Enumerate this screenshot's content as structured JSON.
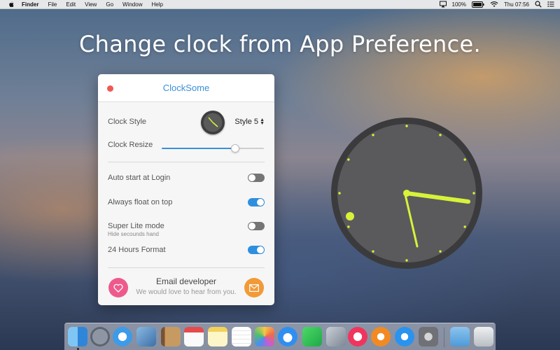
{
  "menubar": {
    "items": [
      {
        "label": "Finder",
        "bold": true
      },
      {
        "label": "File"
      },
      {
        "label": "Edit"
      },
      {
        "label": "View"
      },
      {
        "label": "Go"
      },
      {
        "label": "Window"
      },
      {
        "label": "Help"
      }
    ],
    "battery_percent": "100%",
    "clock": "Thu 07:56"
  },
  "headline": "Change clock from App Preference.",
  "panel": {
    "title": "ClockSome",
    "clock_style_label": "Clock Style",
    "clock_style_value": "Style 5",
    "clock_resize_label": "Clock Resize",
    "clock_resize_level": 0.72,
    "toggles": [
      {
        "label": "Auto start at Login",
        "sublabel": "",
        "on": false
      },
      {
        "label": "Always float on top",
        "sublabel": "",
        "on": true
      },
      {
        "label": "Super Lite mode",
        "sublabel": "Hide secounds hand",
        "on": false
      },
      {
        "label": "24 Hours Format",
        "sublabel": "",
        "on": true
      }
    ],
    "email_title": "Email developer",
    "email_subtitle": "We would love to hear from you."
  },
  "colors": {
    "accent": "#3a8fd9",
    "clock_hands": "#d8f23a",
    "heart": "#ee5a8b",
    "mail": "#f29a38"
  },
  "dock": {
    "icons": [
      "finder-icon",
      "launchpad-icon",
      "safari-icon",
      "preview-photo-icon",
      "contacts-icon",
      "calendar-icon",
      "notes-icon",
      "reminders-icon",
      "photos-icon",
      "messages-icon",
      "facetime-icon",
      "image-capture-icon",
      "itunes-icon",
      "ibooks-icon",
      "app-store-icon",
      "system-preferences-icon",
      "downloads-folder-icon",
      "trash-icon"
    ]
  }
}
